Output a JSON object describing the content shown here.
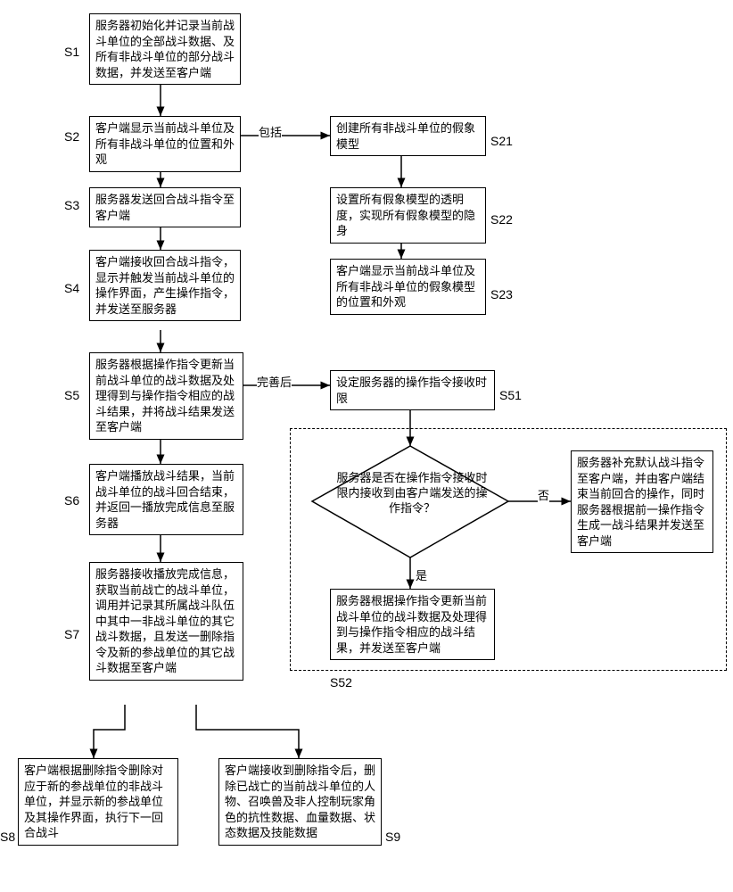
{
  "chart_data": {
    "type": "flowchart",
    "nodes": [
      {
        "id": "S1",
        "type": "process",
        "text": "服务器初始化并记录当前战斗单位的全部战斗数据、及所有非战斗单位的部分战斗数据，并发送至客户端"
      },
      {
        "id": "S2",
        "type": "process",
        "text": "客户端显示当前战斗单位及所有非战斗单位的位置和外观"
      },
      {
        "id": "S21",
        "type": "process",
        "text": "创建所有非战斗单位的假象模型"
      },
      {
        "id": "S22",
        "type": "process",
        "text": "设置所有假象模型的透明度，实现所有假象模型的隐身"
      },
      {
        "id": "S23",
        "type": "process",
        "text": "客户端显示当前战斗单位及所有非战斗单位的假象模型的位置和外观"
      },
      {
        "id": "S3",
        "type": "process",
        "text": "服务器发送回合战斗指令至客户端"
      },
      {
        "id": "S4",
        "type": "process",
        "text": "客户端接收回合战斗指令，显示并触发当前战斗单位的操作界面，产生操作指令，并发送至服务器"
      },
      {
        "id": "S5",
        "type": "process",
        "text": "服务器根据操作指令更新当前战斗单位的战斗数据及处理得到与操作指令相应的战斗结果，并将战斗结果发送至客户端"
      },
      {
        "id": "S51",
        "type": "process",
        "text": "设定服务器的操作指令接收时限"
      },
      {
        "id": "S52",
        "type": "group",
        "text": ""
      },
      {
        "id": "S52d",
        "type": "decision",
        "text": "服务器是否在操作指令接收时限内接收到由客户端发送的操作指令？"
      },
      {
        "id": "S52y",
        "type": "process",
        "text": "服务器根据操作指令更新当前战斗单位的战斗数据及处理得到与操作指令相应的战斗结果，并发送至客户端"
      },
      {
        "id": "S52n",
        "type": "process",
        "text": "服务器补充默认战斗指令至客户端，并由客户端结束当前回合的操作，同时服务器根据前一操作指令生成一战斗结果并发送至客户端"
      },
      {
        "id": "S6",
        "type": "process",
        "text": "客户端播放战斗结果，当前战斗单位的战斗回合结束，并返回一播放完成信息至服务器"
      },
      {
        "id": "S7",
        "type": "process",
        "text": "服务器接收播放完成信息，获取当前战亡的战斗单位，调用并记录其所属战斗队伍中其中一非战斗单位的其它战斗数据，且发送一删除指令及新的参战单位的其它战斗数据至客户端"
      },
      {
        "id": "S8",
        "type": "process",
        "text": "客户端根据删除指令删除对应于新的参战单位的非战斗单位，并显示新的参战单位及其操作界面，执行下一回合战斗"
      },
      {
        "id": "S9",
        "type": "process",
        "text": "客户端接收到删除指令后，删除已战亡的当前战斗单位的人物、召唤兽及非人控制玩家角色的抗性数据、血量数据、状态数据及技能数据"
      }
    ],
    "edges": [
      {
        "from": "S1",
        "to": "S2",
        "label": ""
      },
      {
        "from": "S2",
        "to": "S21",
        "label": "包括"
      },
      {
        "from": "S21",
        "to": "S22",
        "label": ""
      },
      {
        "from": "S22",
        "to": "S23",
        "label": ""
      },
      {
        "from": "S2",
        "to": "S3",
        "label": ""
      },
      {
        "from": "S3",
        "to": "S4",
        "label": ""
      },
      {
        "from": "S4",
        "to": "S5",
        "label": ""
      },
      {
        "from": "S5",
        "to": "S51",
        "label": "完善后"
      },
      {
        "from": "S51",
        "to": "S52d",
        "label": ""
      },
      {
        "from": "S52d",
        "to": "S52y",
        "label": "是"
      },
      {
        "from": "S52d",
        "to": "S52n",
        "label": "否"
      },
      {
        "from": "S5",
        "to": "S6",
        "label": ""
      },
      {
        "from": "S6",
        "to": "S7",
        "label": ""
      },
      {
        "from": "S7",
        "to": "S8",
        "label": ""
      },
      {
        "from": "S7",
        "to": "S9",
        "label": ""
      }
    ]
  },
  "labels": {
    "S1": "S1",
    "S2": "S2",
    "S3": "S3",
    "S4": "S4",
    "S5": "S5",
    "S6": "S6",
    "S7": "S7",
    "S8": "S8",
    "S9": "S9",
    "S21": "S21",
    "S22": "S22",
    "S23": "S23",
    "S51": "S51",
    "S52": "S52",
    "includes": "包括",
    "after_improve": "完善后",
    "yes": "是",
    "no": "否"
  },
  "boxes": {
    "S1": "服务器初始化并记录当前战斗单位的全部战斗数据、及所有非战斗单位的部分战斗数据，并发送至客户端",
    "S2": "客户端显示当前战斗单位及所有非战斗单位的位置和外观",
    "S21": "创建所有非战斗单位的假象模型",
    "S22": "设置所有假象模型的透明度，实现所有假象模型的隐身",
    "S23": "客户端显示当前战斗单位及所有非战斗单位的假象模型的位置和外观",
    "S3": "服务器发送回合战斗指令至客户端",
    "S4": "客户端接收回合战斗指令，显示并触发当前战斗单位的操作界面，产生操作指令，并发送至服务器",
    "S5": "服务器根据操作指令更新当前战斗单位的战斗数据及处理得到与操作指令相应的战斗结果，并将战斗结果发送至客户端",
    "S51": "设定服务器的操作指令接收时限",
    "S52d": "服务器是否在操作指令接收时限内接收到由客户端发送的操作指令？",
    "S52y": "服务器根据操作指令更新当前战斗单位的战斗数据及处理得到与操作指令相应的战斗结果，并发送至客户端",
    "S52n": "服务器补充默认战斗指令至客户端，并由客户端结束当前回合的操作，同时服务器根据前一操作指令生成一战斗结果并发送至客户端",
    "S6": "客户端播放战斗结果，当前战斗单位的战斗回合结束，并返回一播放完成信息至服务器",
    "S7": "服务器接收播放完成信息，获取当前战亡的战斗单位，调用并记录其所属战斗队伍中其中一非战斗单位的其它战斗数据，且发送一删除指令及新的参战单位的其它战斗数据至客户端",
    "S8": "客户端根据删除指令删除对应于新的参战单位的非战斗单位，并显示新的参战单位及其操作界面，执行下一回合战斗",
    "S9": "客户端接收到删除指令后，删除已战亡的当前战斗单位的人物、召唤兽及非人控制玩家角色的抗性数据、血量数据、状态数据及技能数据"
  }
}
